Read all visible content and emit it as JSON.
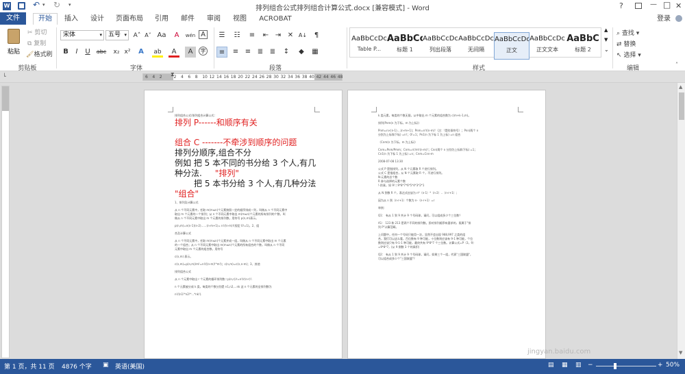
{
  "title": {
    "text": "排列组合公式排列组合计算公式.docx [兼容模式] - Word",
    "help": "?",
    "restore": "▭",
    "minimize": "—",
    "maximize": "□",
    "close": "✕"
  },
  "tabs": {
    "file": "文件",
    "home": "开始",
    "insert": "插入",
    "design": "设计",
    "layout": "页面布局",
    "references": "引用",
    "mailings": "邮件",
    "review": "审阅",
    "view": "视图",
    "acrobat": "ACROBAT",
    "login": "登录"
  },
  "clipboard": {
    "paste": "粘贴",
    "cut": "剪切",
    "copy": "复制",
    "painter": "格式刷",
    "label": "剪贴板"
  },
  "font": {
    "name": "宋体",
    "size": "五号",
    "label": "字体",
    "grow": "A˄",
    "shrink": "A˅",
    "case": "Aa",
    "clear": "A",
    "pinyin": "wén",
    "border": "A",
    "bold": "B",
    "italic": "I",
    "underline": "U",
    "strike": "abc",
    "sub": "x₂",
    "sup": "x²",
    "effects": "A",
    "highlight": "ab",
    "color": "A",
    "shading": "A",
    "circle": "字"
  },
  "paragraph": {
    "label": "段落",
    "sort": "A↓",
    "marks": "¶"
  },
  "styles": {
    "label": "样式",
    "items": [
      {
        "preview": "AaBbCcDc",
        "name": "Table P..."
      },
      {
        "preview": "AaBbCc",
        "name": "标题 1"
      },
      {
        "preview": "AaBbCcDc",
        "name": "列出段落"
      },
      {
        "preview": "AaBbCcDc",
        "name": "无间隔"
      },
      {
        "preview": "AaBbCcDc",
        "name": "正文"
      },
      {
        "preview": "AaBbCcDc",
        "name": "正文文本"
      },
      {
        "preview": "AaBbC",
        "name": "标题 2"
      }
    ]
  },
  "editing": {
    "find": "查找",
    "replace": "替换",
    "select": "选择",
    "label": "编辑"
  },
  "ruler": {
    "ticks": [
      "6",
      "4",
      "2",
      "",
      "2",
      "4",
      "6",
      "8",
      "10",
      "12",
      "14",
      "16",
      "18",
      "20",
      "22",
      "24",
      "26",
      "28",
      "30",
      "32",
      "34",
      "36",
      "38",
      "40",
      "42",
      "44",
      "46",
      "48"
    ]
  },
  "page1": {
    "line0": "排列组合公式/排列组合计算公式：",
    "line1": "排列  P------和顺序有关",
    "line2": "组合  C -------不牵涉到顺序的问题",
    "line3": "排列分顺序,组合不分",
    "line4": "例如  把 5 本不同的书分给 3 个人,有几",
    "line5a": "种分法.",
    "line5b": "\"排列\"",
    "line6": "把 5 本书分给 3 个人,有几种分法",
    "line7": "\"组合\"",
    "small": [
      "1、排列及计算公式",
      "从 n 个不同元素中，任取 m(m≤n)个元素按照一定的顺序排成一列，叫做从 n 个不同元素中",
      "取出 m 个元素的一个排列；从 n 个不同元素中取出 m(m≤n)个元素的所有排列的个数，叫",
      "做从 n 个不同元素中取出 m 个元素的排列数，用符号 p(n,m)表示。",
      "p(n,m)=n(n-1)(n-2)……(n-m+1)= n!/(n-m)!(规定 0!=1)。2、组",
      "合及计算公式",
      "从 n 个不同元素中，任取 m(m≤n)个元素并成一组，叫做从 n 个不同元素中取出 m 个元素",
      "的一个组合；从 n 个不同元素中取出 m(m≤n)个元素的所有组合的个数，叫做从 n 个不同",
      "元素中取出 m 个元素的组合数，用符号",
      "c(n,m) 表示。",
      "c(n,m)=p(n,m)/m!=n!/((n-m)!*m!)；c(n,m)=c(n,n-m)；3、其他",
      "排列组合公式",
      "从 n 个元素中取出 r 个元素的循环排列数＝p(n,r)/r=n!/r(n-r)!.",
      "n 个元素被分成 k 类，每类的个数分别是 n1,n2,...nk 这 n 个元素的全排列数为",
      "n!/(n1!*n2!*...*nk!)."
    ]
  },
  "page2": {
    "small": [
      "k 类元素，每类的个数无限，从中取出 m 个元素的组合数为 c(m+k-1,m)。",
      "排列(Pnm(n 为下标，m 为上标))",
      "Pnm=n×(n-1)....(n-m+1)；Pnm=n!/(n-m)!（注：!是阶乘符号）；Pnn(两个 n",
      "分别为上标和下标) =n!；0!=1；Pn1(n 为下标 1 为上标) =n 组合",
      "（Cnm(n 为下标，m 为上标)）",
      "Cnm=Pnm/Pmm；Cnm=n!/m!(n-m)!；Cnn(两个 n 分别为上标和下标) =1；",
      "Cn1(n 为下标 1 为上标) =n；Cnm=Cnn-m",
      "2008-07-08 13:30",
      "",
      " 公式 P 是指排列，从 N 个元素取 R 个进行排列。",
      "公式 C 是指组合，从 N 个元素取 R 个，不进行排列。",
      "N-元素的总个数",
      "R 参与选择的元素个数",
      "!-阶乘，如     9!＝9*8*7*6*5*4*3*2*1",
      "从 N 到数 R 个，表达式应该为 n*（n-1）*（n-2）..（n-r+1）;",
      "因为从 n 到（n-r+1）个数为 n-（n-r+1）=r",
      "举例：",
      "Q1：     有从 1 到 9 共计 9 个号码球，请问，可以组成多少个三位数？",
      "A1：     123 和 213 是两个不同的排列数。即对排列顺序有要求的，既属于\"排",
      "列 P\"计算范畴。",
      "     上问题中，任何一个号码只能用一次，显然不会出现 988,997 之类的组",
      "合，我们可以这么看，百位数有 9 种可能，十位数则应该有 9-1 种可能，个位",
      "数则应该只有 9-1-1 种可能，最终共有 9*8*7 个三位数。计算公式=P（3，9）",
      "=9*8*7，(从 9 倒数 3 个的乘积)",
      "Q2：     有从 1 到 9 共计 9 个号码球，请问，如果三个一组，代表\"三国联盟\"，",
      "可以组合成多少个\"三国联盟\"？"
    ]
  },
  "status": {
    "page": "第 1 页，共 11 页",
    "words": "4876 个字",
    "lang": "英语(美国)",
    "zoom": "50%",
    "watermark": "jingyan.baidu.com"
  }
}
